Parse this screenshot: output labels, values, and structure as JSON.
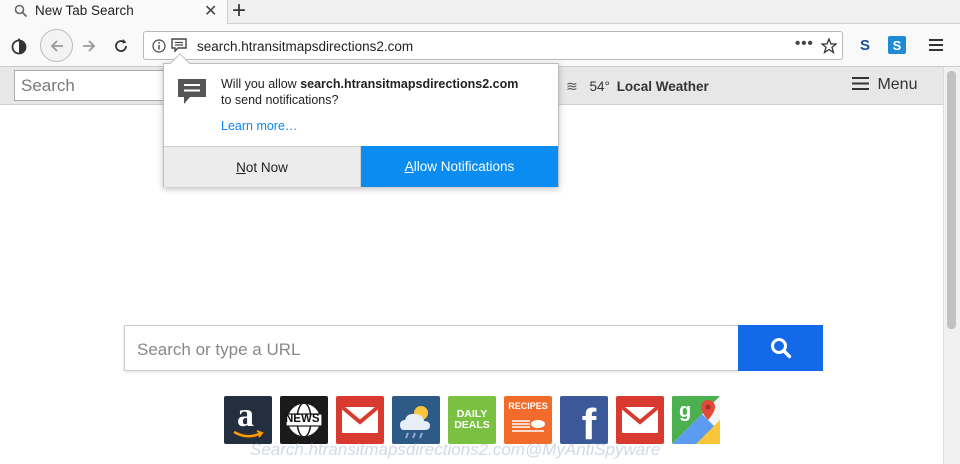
{
  "tab": {
    "title": "New Tab Search",
    "close": "✕",
    "new_tab": "+"
  },
  "toolbar": {
    "url": "search.htransitmapsdirections2.com",
    "more": "•••"
  },
  "page_header": {
    "search_placeholder": "Search",
    "weather_temp": "54°",
    "weather_label": "Local Weather",
    "menu_label": "Menu"
  },
  "popup": {
    "msg_prefix": "Will you allow ",
    "msg_domain": "search.htransitmapsdirections2.com",
    "msg_suffix": "to send notifications?",
    "learn_more": "Learn more…",
    "not_now_first": "N",
    "not_now_rest": "ot Now",
    "allow_first": "A",
    "allow_rest": "llow Notifications"
  },
  "main": {
    "search_placeholder": "Search or type a URL"
  },
  "tiles": [
    {
      "name": "amazon",
      "label": "a",
      "color": "#232f3e"
    },
    {
      "name": "news",
      "label": "NEWS",
      "color": "#1a1a1a"
    },
    {
      "name": "gmail",
      "label": "M",
      "color": "#d93a2f"
    },
    {
      "name": "weather",
      "label": "",
      "color": "#2e5a87"
    },
    {
      "name": "daily-deals",
      "label": "DAILY DEALS",
      "color": "#7ac142"
    },
    {
      "name": "recipes",
      "label": "RECIPES",
      "color": "#f26b2a"
    },
    {
      "name": "facebook",
      "label": "f",
      "color": "#3b5998"
    },
    {
      "name": "gmail-2",
      "label": "M",
      "color": "#d93a2f"
    },
    {
      "name": "maps",
      "label": "g",
      "color": "#4caf50"
    }
  ],
  "watermark": "Search.htransitmapsdirections2.com@MyAntiSpyware",
  "colors": {
    "accent": "#0a8cf0",
    "search_button": "#1369e8"
  }
}
